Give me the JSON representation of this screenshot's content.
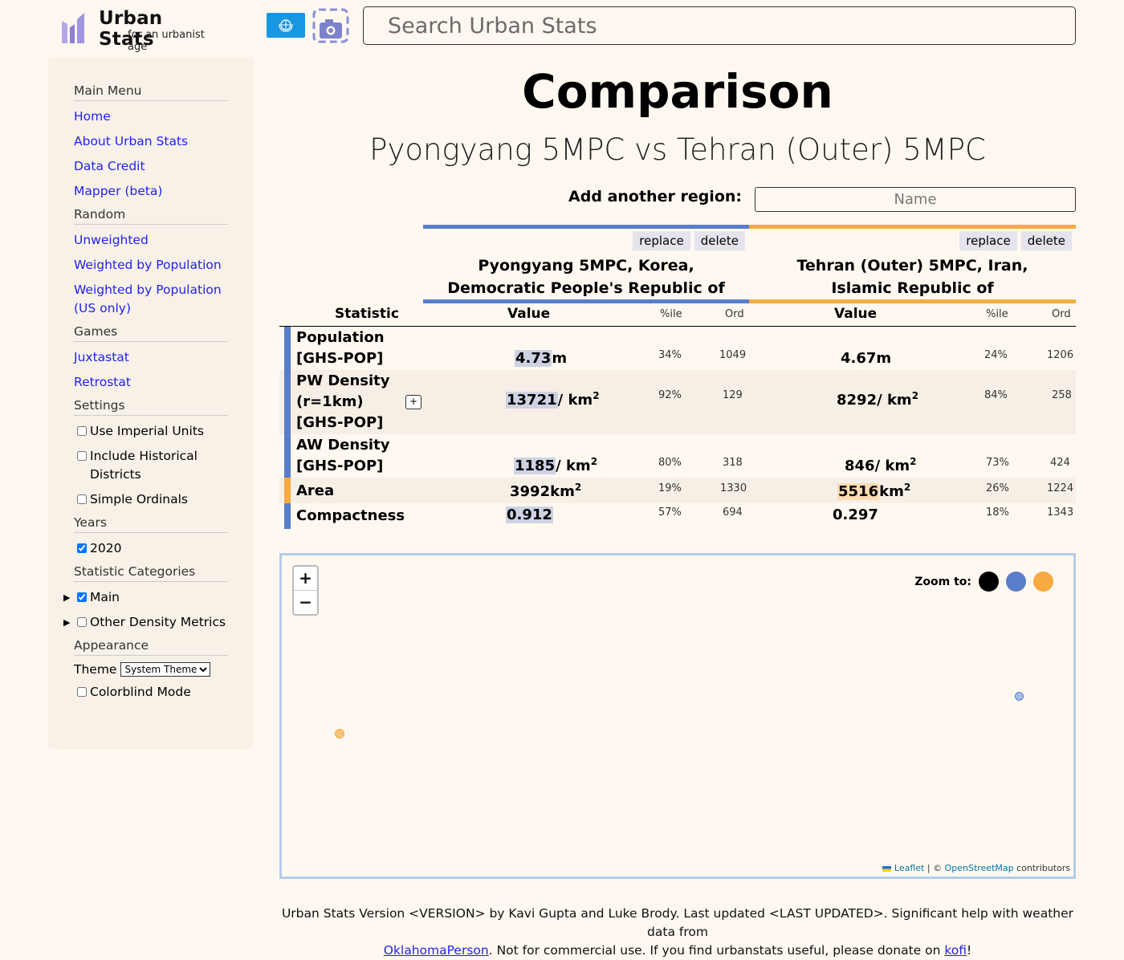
{
  "header": {
    "logo_title": "Urban Stats",
    "logo_subtitle": "for an urbanist age",
    "search_placeholder": "Search Urban Stats"
  },
  "sidebar": {
    "main_menu_heading": "Main Menu",
    "main_menu": [
      "Home",
      "About Urban Stats",
      "Data Credit",
      "Mapper (beta)"
    ],
    "random_heading": "Random",
    "random": [
      "Unweighted",
      "Weighted by Population",
      "Weighted by Population (US only)"
    ],
    "games_heading": "Games",
    "games": [
      "Juxtastat",
      "Retrostat"
    ],
    "settings_heading": "Settings",
    "settings": [
      {
        "label": "Use Imperial Units",
        "checked": false
      },
      {
        "label": "Include Historical Districts",
        "checked": false
      },
      {
        "label": "Simple Ordinals",
        "checked": false
      }
    ],
    "years_heading": "Years",
    "years": [
      {
        "label": "2020",
        "checked": true
      }
    ],
    "categories_heading": "Statistic Categories",
    "categories": [
      {
        "label": "Main",
        "checked": true
      },
      {
        "label": "Other Density Metrics",
        "checked": false
      }
    ],
    "appearance_heading": "Appearance",
    "theme_label": "Theme",
    "theme_value": "System Theme",
    "colorblind_label": "Colorblind Mode",
    "colorblind_checked": false
  },
  "page": {
    "title": "Comparison",
    "subtitle": "Pyongyang 5MPC vs Tehran (Outer) 5MPC",
    "add_region_label": "Add another region:",
    "add_region_placeholder": "Name"
  },
  "regions": [
    {
      "name": "Pyongyang 5MPC, Korea, Democratic People's Republic of",
      "color": "#5a7dc9",
      "replace": "replace",
      "delete": "delete"
    },
    {
      "name": "Tehran (Outer) 5MPC, Iran, Islamic Republic of",
      "color": "#f7aa41",
      "replace": "replace",
      "delete": "delete"
    }
  ],
  "table": {
    "headers": {
      "statistic": "Statistic",
      "value": "Value",
      "pctile": "%ile",
      "ord": "Ord"
    },
    "rows": [
      {
        "stat": "Population [GHS-POP]",
        "a": {
          "value": "4.73",
          "unit": "m",
          "pct": "34%",
          "ord": "1049"
        },
        "b": {
          "value": "4.67",
          "unit": "m",
          "pct": "24%",
          "ord": "1206"
        }
      },
      {
        "stat": "PW Density (r=1km) [GHS-POP]",
        "expand": "+",
        "a": {
          "value": "13721",
          "unit": "/ km",
          "pct": "92%",
          "ord": "129"
        },
        "b": {
          "value": "8292",
          "unit": "/ km",
          "pct": "84%",
          "ord": "258"
        }
      },
      {
        "stat": "AW Density [GHS-POP]",
        "a": {
          "value": "1185",
          "unit": "/ km",
          "pct": "80%",
          "ord": "318"
        },
        "b": {
          "value": "846",
          "unit": "/ km",
          "pct": "73%",
          "ord": "424"
        }
      },
      {
        "stat": "Area",
        "a": {
          "value": "3992",
          "unit": "km",
          "pct": "19%",
          "ord": "1330"
        },
        "b": {
          "value": "5516",
          "unit": "km",
          "pct": "26%",
          "ord": "1224"
        }
      },
      {
        "stat": "Compactness",
        "a": {
          "value": "0.912",
          "unit": "",
          "pct": "57%",
          "ord": "694"
        },
        "b": {
          "value": "0.297",
          "unit": "",
          "pct": "18%",
          "ord": "1343"
        }
      }
    ],
    "superscript": "2"
  },
  "map": {
    "zoom_in": "+",
    "zoom_out": "−",
    "zoom_to_label": "Zoom to:",
    "zoom_colors": [
      "#000000",
      "#5a7dc9",
      "#f7aa41"
    ],
    "attribution_leaflet": "Leaflet",
    "attribution_sep": " | © ",
    "attribution_osm": "OpenStreetMap",
    "attribution_tail": " contributors"
  },
  "footer": {
    "line1": "Urban Stats Version <VERSION> by Kavi Gupta and Luke Brody. Last updated <LAST UPDATED>. Significant help with weather data from",
    "link1": "OklahomaPerson",
    "mid": ". Not for commercial use. If you find urbanstats useful, please donate on ",
    "link2": "kofi",
    "end": "!"
  }
}
